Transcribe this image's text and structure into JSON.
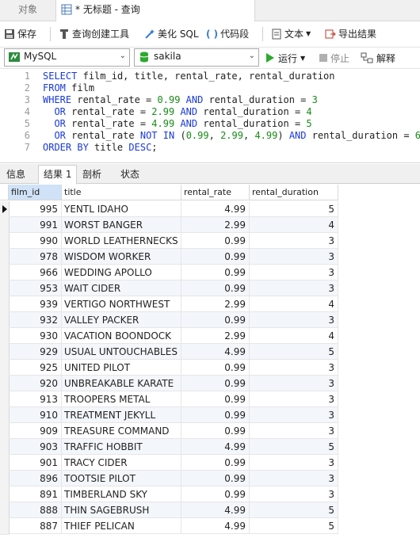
{
  "tabs": {
    "objects_label": "对象",
    "query_label": "* 无标题 - 查询"
  },
  "toolbar": {
    "save_label": "保存",
    "query_builder_label": "查询创建工具",
    "beautify_label": "美化 SQL",
    "snippet_label": "代码段",
    "text_label": "文本",
    "export_label": "导出结果"
  },
  "connection": {
    "db_type": "MySQL",
    "database": "sakila",
    "run_label": "运行",
    "stop_label": "停止",
    "explain_label": "解释"
  },
  "sql": {
    "lines": [
      "1",
      "2",
      "3",
      "4",
      "5",
      "6",
      "7"
    ]
  },
  "result_tabs": {
    "info": "信息",
    "result1": "结果 1",
    "profile": "剖析",
    "status": "状态"
  },
  "grid": {
    "columns": [
      "film_id",
      "title",
      "rental_rate",
      "rental_duration"
    ],
    "rows": [
      [
        "995",
        "YENTL IDAHO",
        "4.99",
        "5"
      ],
      [
        "991",
        "WORST BANGER",
        "2.99",
        "4"
      ],
      [
        "990",
        "WORLD LEATHERNECKS",
        "0.99",
        "3"
      ],
      [
        "978",
        "WISDOM WORKER",
        "0.99",
        "3"
      ],
      [
        "966",
        "WEDDING APOLLO",
        "0.99",
        "3"
      ],
      [
        "953",
        "WAIT CIDER",
        "0.99",
        "3"
      ],
      [
        "939",
        "VERTIGO NORTHWEST",
        "2.99",
        "4"
      ],
      [
        "932",
        "VALLEY PACKER",
        "0.99",
        "3"
      ],
      [
        "930",
        "VACATION BOONDOCK",
        "2.99",
        "4"
      ],
      [
        "929",
        "USUAL UNTOUCHABLES",
        "4.99",
        "5"
      ],
      [
        "925",
        "UNITED PILOT",
        "0.99",
        "3"
      ],
      [
        "920",
        "UNBREAKABLE KARATE",
        "0.99",
        "3"
      ],
      [
        "913",
        "TROOPERS METAL",
        "0.99",
        "3"
      ],
      [
        "910",
        "TREATMENT JEKYLL",
        "0.99",
        "3"
      ],
      [
        "909",
        "TREASURE COMMAND",
        "0.99",
        "3"
      ],
      [
        "903",
        "TRAFFIC HOBBIT",
        "4.99",
        "5"
      ],
      [
        "901",
        "TRACY CIDER",
        "0.99",
        "3"
      ],
      [
        "896",
        "TOOTSIE PILOT",
        "0.99",
        "3"
      ],
      [
        "891",
        "TIMBERLAND SKY",
        "0.99",
        "3"
      ],
      [
        "888",
        "THIN SAGEBRUSH",
        "4.99",
        "5"
      ],
      [
        "887",
        "THIEF PELICAN",
        "4.99",
        "5"
      ]
    ]
  },
  "colors": {
    "keyword": "#1a3ad8",
    "number": "#1a8a1a",
    "run": "#2ea82e",
    "header_selected": "#cfe2f7"
  }
}
